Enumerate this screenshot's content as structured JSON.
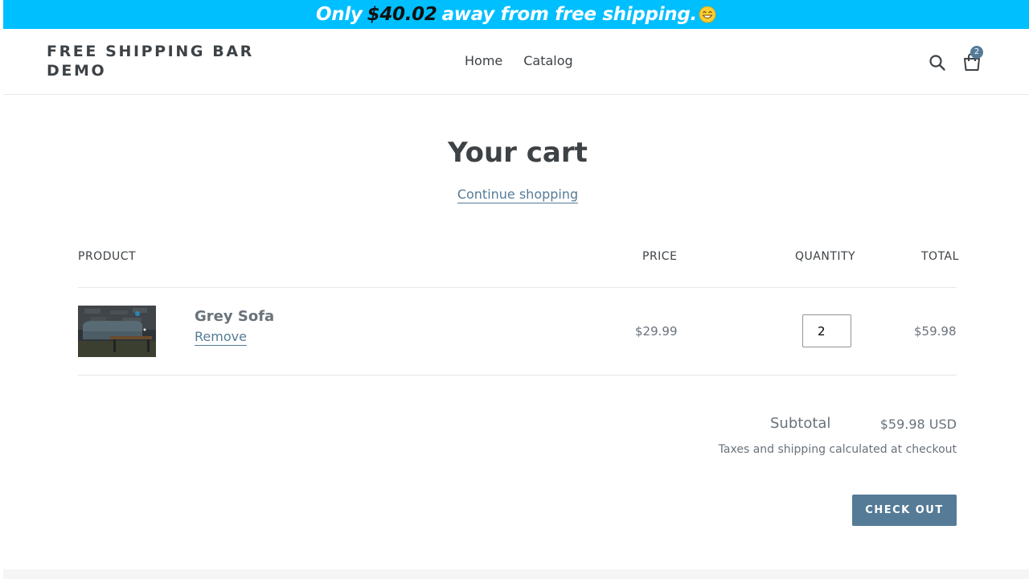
{
  "announcement": {
    "prefix": "Only",
    "amount": "$40.02",
    "suffix": "away from free shipping.",
    "emoji": "grinning-face-emoji",
    "background": "#00bfff"
  },
  "header": {
    "logo": "FREE SHIPPING BAR DEMO",
    "nav": [
      {
        "label": "Home"
      },
      {
        "label": "Catalog"
      }
    ],
    "search_icon": "search-icon",
    "cart_icon": "shopping-bag-icon",
    "cart_count": "2"
  },
  "cart": {
    "title": "Your cart",
    "continue_label": "Continue shopping",
    "columns": {
      "product": "PRODUCT",
      "price": "PRICE",
      "quantity": "QUANTITY",
      "total": "TOTAL"
    },
    "items": [
      {
        "name": "Grey Sofa",
        "remove_label": "Remove",
        "price": "$29.99",
        "quantity": "2",
        "total": "$59.98"
      }
    ],
    "subtotal_label": "Subtotal",
    "subtotal_value": "$59.98 USD",
    "tax_note": "Taxes and shipping calculated at checkout",
    "checkout_label": "CHECK OUT"
  },
  "colors": {
    "accent": "#557b97",
    "text": "#3d4246",
    "muted": "#69727b"
  }
}
